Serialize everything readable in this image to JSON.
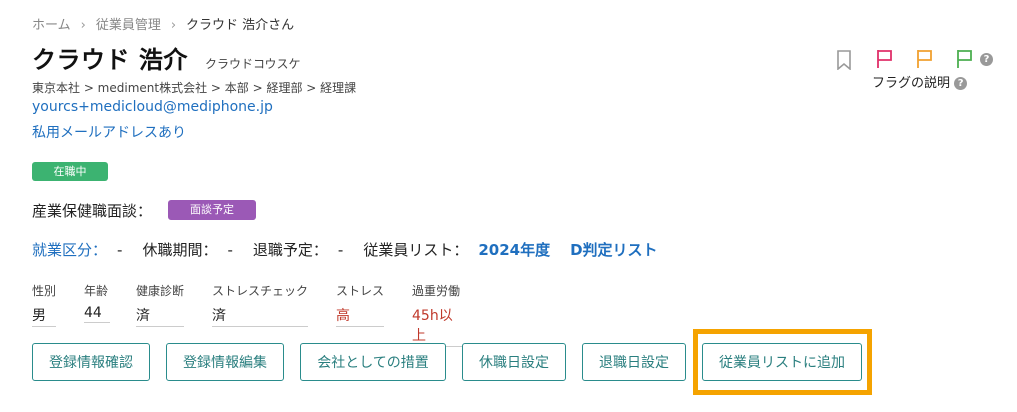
{
  "breadcrumb": {
    "home": "ホーム",
    "employees": "従業員管理",
    "current": "クラウド 浩介さん",
    "separator": "›"
  },
  "employee": {
    "name": "クラウド 浩介",
    "kana": "クラウドコウスケ",
    "organization": "東京本社 > mediment株式会社 > 本部 > 経理部 > 経理課",
    "email": "yourcs+medicloud@mediphone.jp",
    "private_email_note": "私用メールアドレスあり",
    "employment_badge": "在職中"
  },
  "interview": {
    "label": "産業保健職面談：",
    "badge": "面談予定"
  },
  "status": {
    "work_type_label": "就業区分：",
    "work_type_value": "-",
    "leave_label": "休職期間：",
    "leave_value": "-",
    "retire_label": "退職予定：",
    "retire_value": "-",
    "list_label": "従業員リスト：",
    "list_value_1": "2024年度",
    "list_value_2": "D判定リスト"
  },
  "fields": [
    {
      "label": "性別",
      "value": "男"
    },
    {
      "label": "年齢",
      "value": "44"
    },
    {
      "label": "健康診断",
      "value": "済"
    },
    {
      "label": "ストレスチェック",
      "value": "済"
    },
    {
      "label": "ストレス",
      "value": "高"
    },
    {
      "label": "過重労働",
      "value": "45h以上"
    }
  ],
  "buttons": {
    "confirm": "登録情報確認",
    "edit": "登録情報編集",
    "company_measures": "会社としての措置",
    "leave_date": "休職日設定",
    "retire_date": "退職日設定",
    "add_to_list": "従業員リストに追加"
  },
  "flags": {
    "help_label": "フラグの説明",
    "help_icon": "?",
    "colors": {
      "pink": "#e0306a",
      "orange": "#f0a030",
      "green": "#4caf50",
      "gray": "#999999"
    }
  },
  "colors": {
    "link": "#1f6fbf",
    "badge_employed": "#3cb371",
    "badge_interview": "#9b59b6",
    "alert_text": "#c0392b",
    "button_border": "#2a8c8c",
    "highlight": "#f5a300"
  }
}
